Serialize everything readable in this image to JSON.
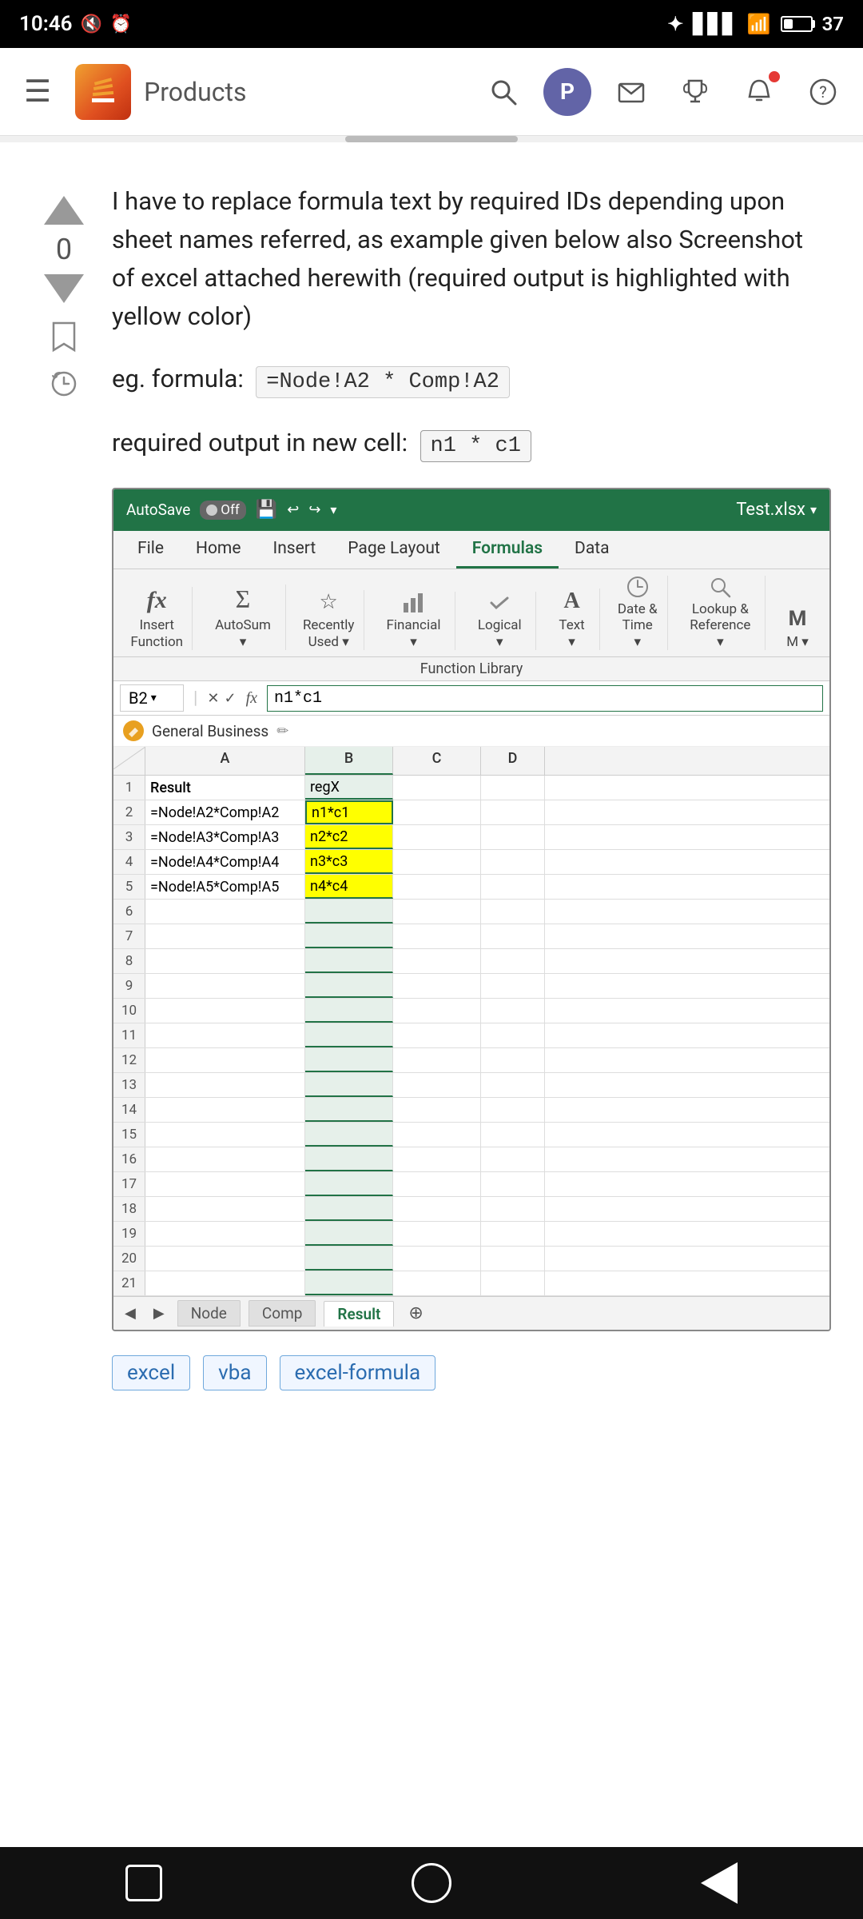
{
  "statusBar": {
    "time": "10:46",
    "batteryLevel": "37"
  },
  "topNav": {
    "productLabel": "Products",
    "pButtonLabel": "P"
  },
  "post": {
    "voteCount": "0",
    "body": "I have to replace formula text by required IDs depending upon sheet names referred, as example given below also Screenshot of excel attached herewith (required output is highlighted with yellow color)",
    "exampleLabel": "eg. formula:",
    "formulaCode": "=Node!A2 * Comp!A2",
    "outputLabel": "required output in new cell:",
    "outputCode": "n1 * c1"
  },
  "excel": {
    "autosaveLabel": "AutoSave",
    "autosaveState": "Off",
    "saveIcon": "💾",
    "filename": "Test.xlsx",
    "menuTabs": [
      "File",
      "Home",
      "Insert",
      "Page Layout",
      "Formulas",
      "Data"
    ],
    "activeTab": "Formulas",
    "ribbonGroups": [
      {
        "icon": "fx",
        "label": "Insert\nFunction"
      },
      {
        "icon": "Σ",
        "label": "AutoSum\n▾"
      },
      {
        "icon": "☆",
        "label": "Recently\nUsed ▾"
      },
      {
        "icon": "🏦",
        "label": "Financial\n▾"
      },
      {
        "icon": "✔",
        "label": "Logical\n▾"
      },
      {
        "icon": "A",
        "label": "Text\n▾"
      },
      {
        "icon": "🕐",
        "label": "Date &\nTime ▾"
      },
      {
        "icon": "🔍",
        "label": "Lookup &\nReference ▾"
      },
      {
        "icon": "M",
        "label": "M\n▾"
      }
    ],
    "functionLibraryLabel": "Function Library",
    "cellRef": "B2",
    "formulaBarContent": "n1*c1",
    "generalBusinessLabel": "General Business",
    "columns": [
      "A",
      "B",
      "C",
      "D"
    ],
    "colHeaders": {
      "cornerLabel": "",
      "A": "A",
      "B": "B",
      "C": "C",
      "D": "D"
    },
    "rows": [
      {
        "num": "1",
        "A": "Result",
        "B": "regX",
        "C": "",
        "D": "",
        "rowType": "header"
      },
      {
        "num": "2",
        "A": "=Node!A2*Comp!A2",
        "B": "n1*c1",
        "C": "",
        "D": "",
        "rowType": "data",
        "bHighlight": "selected"
      },
      {
        "num": "3",
        "A": "=Node!A3*Comp!A3",
        "B": "n2*c2",
        "C": "",
        "D": "",
        "rowType": "data",
        "bHighlight": "yellow"
      },
      {
        "num": "4",
        "A": "=Node!A4*Comp!A4",
        "B": "n3*c3",
        "C": "",
        "D": "",
        "rowType": "data",
        "bHighlight": "yellow"
      },
      {
        "num": "5",
        "A": "=Node!A5*Comp!A5",
        "B": "n4*c4",
        "C": "",
        "D": "",
        "rowType": "data",
        "bHighlight": "yellow"
      },
      {
        "num": "6",
        "A": "",
        "B": "",
        "C": "",
        "D": ""
      },
      {
        "num": "7",
        "A": "",
        "B": "",
        "C": "",
        "D": ""
      },
      {
        "num": "8",
        "A": "",
        "B": "",
        "C": "",
        "D": ""
      },
      {
        "num": "9",
        "A": "",
        "B": "",
        "C": "",
        "D": ""
      },
      {
        "num": "10",
        "A": "",
        "B": "",
        "C": "",
        "D": ""
      },
      {
        "num": "11",
        "A": "",
        "B": "",
        "C": "",
        "D": ""
      },
      {
        "num": "12",
        "A": "",
        "B": "",
        "C": "",
        "D": ""
      },
      {
        "num": "13",
        "A": "",
        "B": "",
        "C": "",
        "D": ""
      },
      {
        "num": "14",
        "A": "",
        "B": "",
        "C": "",
        "D": ""
      },
      {
        "num": "15",
        "A": "",
        "B": "",
        "C": "",
        "D": ""
      },
      {
        "num": "16",
        "A": "",
        "B": "",
        "C": "",
        "D": ""
      },
      {
        "num": "17",
        "A": "",
        "B": "",
        "C": "",
        "D": ""
      },
      {
        "num": "18",
        "A": "",
        "B": "",
        "C": "",
        "D": ""
      },
      {
        "num": "19",
        "A": "",
        "B": "",
        "C": "",
        "D": ""
      },
      {
        "num": "20",
        "A": "",
        "B": "",
        "C": "",
        "D": ""
      },
      {
        "num": "21",
        "A": "",
        "B": "",
        "C": "",
        "D": ""
      }
    ],
    "sheetTabs": [
      "Node",
      "Comp",
      "Result"
    ],
    "activeSheet": "Result"
  },
  "tags": [
    "excel",
    "vba",
    "excel-formula"
  ],
  "bottomNav": {
    "squareLabel": "square-nav",
    "circleLabel": "home-nav",
    "triangleLabel": "back-nav"
  }
}
